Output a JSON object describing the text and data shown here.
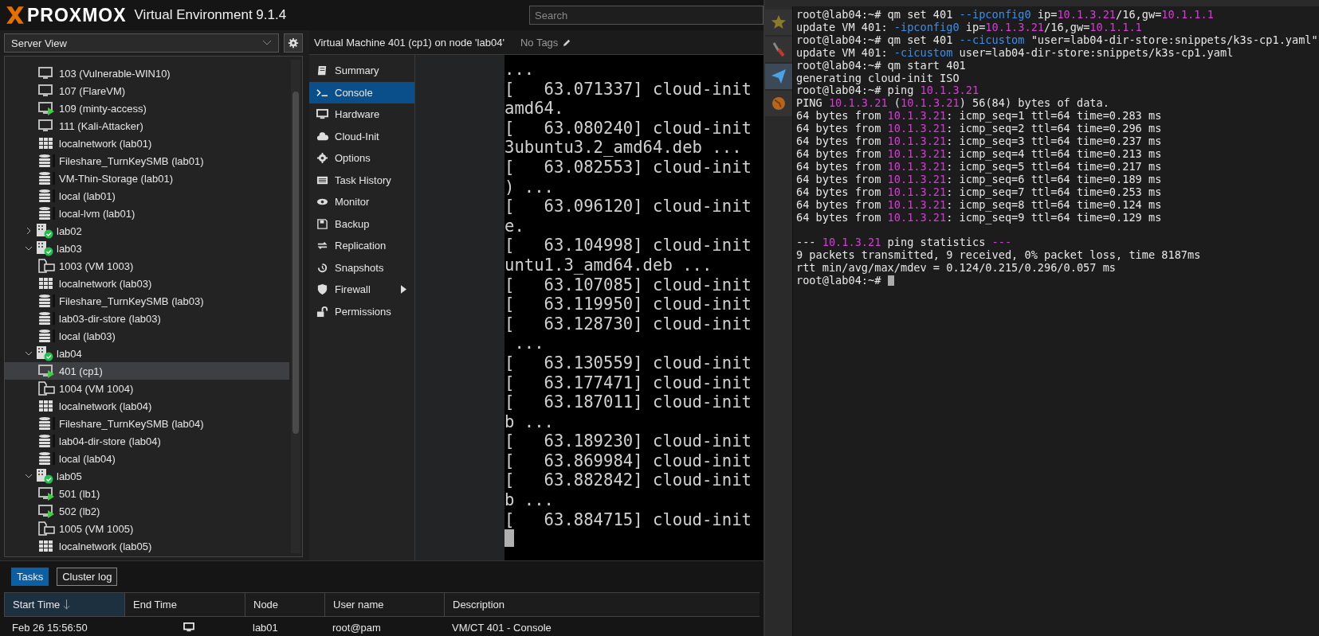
{
  "header": {
    "brand": "PROXMOX",
    "product": "Virtual Environment 9.1.4",
    "search": {
      "placeholder": "Search"
    }
  },
  "view_selector": {
    "value": "Server View"
  },
  "tree": {
    "continued_items": [
      {
        "label": "103 (Vulnerable-WIN10)",
        "kind": "vm",
        "selected": false
      },
      {
        "label": "107 (FlareVM)",
        "kind": "vm",
        "selected": false
      },
      {
        "label": "109 (minty-access)",
        "kind": "vm-running",
        "selected": false
      },
      {
        "label": "111 (Kali-Attacker)",
        "kind": "vm",
        "selected": false
      },
      {
        "label": "localnetwork (lab01)",
        "kind": "network",
        "selected": false
      },
      {
        "label": "Fileshare_TurnKeySMB (lab01)",
        "kind": "storage",
        "selected": false
      },
      {
        "label": "VM-Thin-Storage (lab01)",
        "kind": "storage",
        "selected": false
      },
      {
        "label": "local (lab01)",
        "kind": "storage",
        "selected": false
      },
      {
        "label": "local-lvm (lab01)",
        "kind": "storage",
        "selected": false
      }
    ],
    "nodes": [
      {
        "label": "lab02",
        "expanded": false,
        "selected": false
      },
      {
        "label": "lab03",
        "expanded": true,
        "selected": false,
        "children": [
          {
            "label": "1003 (VM 1003)",
            "kind": "template",
            "selected": false
          },
          {
            "label": "localnetwork (lab03)",
            "kind": "network",
            "selected": false
          },
          {
            "label": "Fileshare_TurnKeySMB (lab03)",
            "kind": "storage",
            "selected": false
          },
          {
            "label": "lab03-dir-store (lab03)",
            "kind": "storage",
            "selected": false
          },
          {
            "label": "local (lab03)",
            "kind": "storage",
            "selected": false
          }
        ]
      },
      {
        "label": "lab04",
        "expanded": true,
        "selected": false,
        "children": [
          {
            "label": "401 (cp1)",
            "kind": "vm-running",
            "selected": true
          },
          {
            "label": "1004 (VM 1004)",
            "kind": "template",
            "selected": false
          },
          {
            "label": "localnetwork (lab04)",
            "kind": "network",
            "selected": false
          },
          {
            "label": "Fileshare_TurnKeySMB (lab04)",
            "kind": "storage",
            "selected": false
          },
          {
            "label": "lab04-dir-store (lab04)",
            "kind": "storage",
            "selected": false
          },
          {
            "label": "local (lab04)",
            "kind": "storage",
            "selected": false
          }
        ]
      },
      {
        "label": "lab05",
        "expanded": true,
        "selected": false,
        "children": [
          {
            "label": "501 (lb1)",
            "kind": "vm-running",
            "selected": false
          },
          {
            "label": "502 (lb2)",
            "kind": "vm-running",
            "selected": false
          },
          {
            "label": "1005 (VM 1005)",
            "kind": "template",
            "selected": false
          },
          {
            "label": "localnetwork (lab05)",
            "kind": "network",
            "selected": false
          }
        ]
      }
    ]
  },
  "content": {
    "title": "Virtual Machine 401 (cp1) on node 'lab04'",
    "tags": "No Tags",
    "nav": [
      {
        "label": "Summary",
        "kind": "summary",
        "selected": false
      },
      {
        "label": "Console",
        "kind": "console",
        "selected": true
      },
      {
        "label": "Hardware",
        "kind": "hardware",
        "selected": false
      },
      {
        "label": "Cloud-Init",
        "kind": "cloud",
        "selected": false
      },
      {
        "label": "Options",
        "kind": "options",
        "selected": false
      },
      {
        "label": "Task History",
        "kind": "history",
        "selected": false
      },
      {
        "label": "Monitor",
        "kind": "monitor",
        "selected": false
      },
      {
        "label": "Backup",
        "kind": "backup",
        "selected": false
      },
      {
        "label": "Replication",
        "kind": "replication",
        "selected": false
      },
      {
        "label": "Snapshots",
        "kind": "snapshots",
        "selected": false
      },
      {
        "label": "Firewall",
        "kind": "firewall",
        "selected": false,
        "submenu": true
      },
      {
        "label": "Permissions",
        "kind": "permissions",
        "selected": false
      }
    ],
    "console_lines": [
      "...",
      "[   63.071337] cloud-init",
      "amd64.",
      "[   63.080240] cloud-init",
      "3ubuntu3.2_amd64.deb ...",
      "[   63.082553] cloud-init",
      ") ...",
      "[   63.096120] cloud-init",
      "e.",
      "[   63.104998] cloud-init",
      "untu1.3_amd64.deb ...",
      "[   63.107085] cloud-init",
      "[   63.119950] cloud-init",
      "[   63.128730] cloud-init",
      " ...",
      "[   63.130559] cloud-init",
      "[   63.177471] cloud-init",
      "[   63.187011] cloud-init",
      "b ...",
      "[   63.189230] cloud-init",
      "[   63.869984] cloud-init",
      "[   63.882842] cloud-init",
      "b ...",
      "[   63.884715] cloud-init"
    ]
  },
  "tasks": {
    "tabs": [
      {
        "label": "Tasks",
        "selected": true
      },
      {
        "label": "Cluster log",
        "selected": false
      }
    ],
    "columns": [
      {
        "label": "Start Time",
        "sorted": true
      },
      {
        "label": "End Time",
        "sorted": false
      },
      {
        "label": "Node",
        "sorted": false
      },
      {
        "label": "User name",
        "sorted": false
      },
      {
        "label": "Description",
        "sorted": false
      }
    ],
    "rows": [
      {
        "start_time": "Feb 26 15:56:50",
        "end_time_console": true,
        "node": "lab01",
        "user": "root@pam",
        "description": "VM/CT 401 - Console"
      }
    ]
  },
  "terminal": {
    "side_tools": [
      {
        "kind": "star",
        "selected": false
      },
      {
        "kind": "tools",
        "selected": false
      },
      {
        "kind": "send",
        "selected": true
      },
      {
        "kind": "globe",
        "selected": false
      }
    ],
    "lines": [
      {
        "segments": [
          {
            "text": "root@lab04:~# qm set 401 ",
            "kind": "plain"
          },
          {
            "text": "--ipconfig0",
            "kind": "flag"
          },
          {
            "text": " ip=",
            "kind": "plain"
          },
          {
            "text": "10.1.3.21",
            "kind": "address"
          },
          {
            "text": "/16,gw=",
            "kind": "plain"
          },
          {
            "text": "10.1.1.1",
            "kind": "address"
          }
        ]
      },
      {
        "segments": [
          {
            "text": "update VM 401: ",
            "kind": "plain"
          },
          {
            "text": "-ipconfig0",
            "kind": "flag"
          },
          {
            "text": " ip=",
            "kind": "plain"
          },
          {
            "text": "10.1.3.21",
            "kind": "address"
          },
          {
            "text": "/16,gw=",
            "kind": "plain"
          },
          {
            "text": "10.1.1.1",
            "kind": "address"
          }
        ]
      },
      {
        "segments": [
          {
            "text": "root@lab04:~# qm set 401 ",
            "kind": "plain"
          },
          {
            "text": "--cicustom",
            "kind": "flag"
          },
          {
            "text": " \"user=lab04-dir-store:snippets/k3s-cp1.yaml\"",
            "kind": "plain"
          }
        ]
      },
      {
        "segments": [
          {
            "text": "update VM 401: ",
            "kind": "plain"
          },
          {
            "text": "-cicustom",
            "kind": "flag"
          },
          {
            "text": " user=lab04-dir-store:snippets/k3s-cp1.yaml",
            "kind": "plain"
          }
        ]
      },
      {
        "segments": [
          {
            "text": "root@lab04:~# qm start 401",
            "kind": "plain"
          }
        ]
      },
      {
        "segments": [
          {
            "text": "generating cloud-init ISO",
            "kind": "plain"
          }
        ]
      },
      {
        "segments": [
          {
            "text": "root@lab04:~# ping ",
            "kind": "plain"
          },
          {
            "text": "10.1.3.21",
            "kind": "address"
          }
        ]
      },
      {
        "segments": [
          {
            "text": "PING ",
            "kind": "plain"
          },
          {
            "text": "10.1.3.21",
            "kind": "address"
          },
          {
            "text": " (",
            "kind": "plain"
          },
          {
            "text": "10.1.3.21",
            "kind": "address"
          },
          {
            "text": ") 56(84) bytes of data.",
            "kind": "plain"
          }
        ]
      },
      {
        "segments": [
          {
            "text": "64 bytes from ",
            "kind": "plain"
          },
          {
            "text": "10.1.3.21",
            "kind": "address"
          },
          {
            "text": ": icmp_seq=1 ttl=64 time=0.283 ms",
            "kind": "plain"
          }
        ]
      },
      {
        "segments": [
          {
            "text": "64 bytes from ",
            "kind": "plain"
          },
          {
            "text": "10.1.3.21",
            "kind": "address"
          },
          {
            "text": ": icmp_seq=2 ttl=64 time=0.296 ms",
            "kind": "plain"
          }
        ]
      },
      {
        "segments": [
          {
            "text": "64 bytes from ",
            "kind": "plain"
          },
          {
            "text": "10.1.3.21",
            "kind": "address"
          },
          {
            "text": ": icmp_seq=3 ttl=64 time=0.237 ms",
            "kind": "plain"
          }
        ]
      },
      {
        "segments": [
          {
            "text": "64 bytes from ",
            "kind": "plain"
          },
          {
            "text": "10.1.3.21",
            "kind": "address"
          },
          {
            "text": ": icmp_seq=4 ttl=64 time=0.213 ms",
            "kind": "plain"
          }
        ]
      },
      {
        "segments": [
          {
            "text": "64 bytes from ",
            "kind": "plain"
          },
          {
            "text": "10.1.3.21",
            "kind": "address"
          },
          {
            "text": ": icmp_seq=5 ttl=64 time=0.217 ms",
            "kind": "plain"
          }
        ]
      },
      {
        "segments": [
          {
            "text": "64 bytes from ",
            "kind": "plain"
          },
          {
            "text": "10.1.3.21",
            "kind": "address"
          },
          {
            "text": ": icmp_seq=6 ttl=64 time=0.189 ms",
            "kind": "plain"
          }
        ]
      },
      {
        "segments": [
          {
            "text": "64 bytes from ",
            "kind": "plain"
          },
          {
            "text": "10.1.3.21",
            "kind": "address"
          },
          {
            "text": ": icmp_seq=7 ttl=64 time=0.253 ms",
            "kind": "plain"
          }
        ]
      },
      {
        "segments": [
          {
            "text": "64 bytes from ",
            "kind": "plain"
          },
          {
            "text": "10.1.3.21",
            "kind": "address"
          },
          {
            "text": ": icmp_seq=8 ttl=64 time=0.124 ms",
            "kind": "plain"
          }
        ]
      },
      {
        "segments": [
          {
            "text": "64 bytes from ",
            "kind": "plain"
          },
          {
            "text": "10.1.3.21",
            "kind": "address"
          },
          {
            "text": ": icmp_seq=9 ttl=64 time=0.129 ms",
            "kind": "plain"
          }
        ]
      },
      {
        "spaced": true,
        "segments": [
          {
            "text": "--- ",
            "kind": "plain"
          },
          {
            "text": "10.1.3.21",
            "kind": "address"
          },
          {
            "text": " ping statistics ",
            "kind": "plain"
          },
          {
            "text": "---",
            "kind": "address"
          }
        ]
      },
      {
        "segments": [
          {
            "text": "9 packets transmitted, 9 received, 0% packet loss, time 8187ms",
            "kind": "plain"
          }
        ]
      },
      {
        "segments": [
          {
            "text": "rtt min/avg/max/mdev = 0.124/0.215/0.296/0.057 ms",
            "kind": "plain"
          }
        ]
      },
      {
        "cursor": true,
        "segments": [
          {
            "text": "root@lab04:~# ",
            "kind": "plain"
          }
        ]
      }
    ]
  }
}
